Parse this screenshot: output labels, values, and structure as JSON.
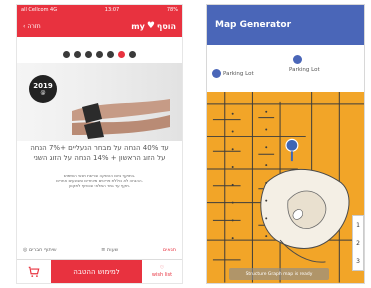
{
  "left": {
    "status": {
      "carrier": "all Cellcom 4G",
      "time": "13:07",
      "battery": "78%"
    },
    "appbar": {
      "back_label": "חזרה",
      "brand_text": "my",
      "brand_suffix": "הוסף"
    },
    "badge": {
      "year": "2019",
      "sub": "@"
    },
    "promo": {
      "line1": "עד 40% הנחה על מבחר הנעליים +7% הנחה",
      "line2": "על הזוג הראשון + 14% הנחה על הזוג השני"
    },
    "fine": {
      "l1": "בתוקף ביום ההשקה וברשת תנאי השימוש.",
      "l2": "ההנחה לא כוללת פריטים מיוחדים ומבצעים אחרים.",
      "l3": "תקף עד גמר המלאי ובכפוף לתקנון."
    },
    "tabs": {
      "a": "שיתוף חברים",
      "b": "שעות",
      "c": "תנאים"
    },
    "bottom": {
      "main": "למימוש ההטבה",
      "wish": "wish list"
    }
  },
  "right": {
    "title": "Map Generator",
    "legend": {
      "left_label": "Parking Lot",
      "right_label": "Parking Lot"
    },
    "zoom": {
      "z1": "1",
      "z2": "2",
      "z3": "3"
    },
    "toast": "Structure Graph map is ready"
  },
  "colors": {
    "brand_red": "#e8323f",
    "map_orange": "#f2a528",
    "appbar_blue": "#4a66b8"
  }
}
